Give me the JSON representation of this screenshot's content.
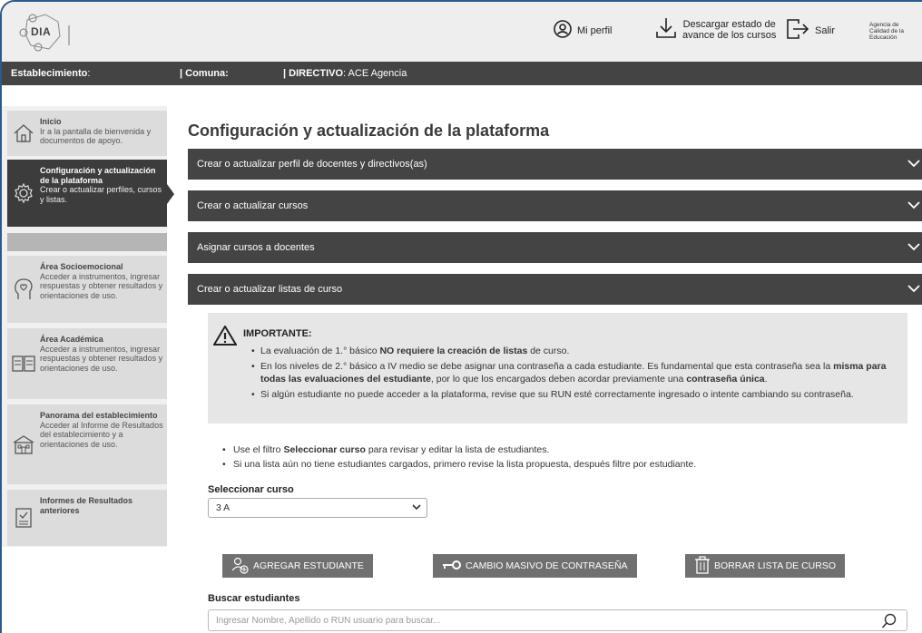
{
  "header": {
    "logo_text": "DIA",
    "profile_label": "Mi perfil",
    "download_line1": "Descargar estado de",
    "download_line2": "avance de los cursos",
    "exit_label": "Salir",
    "agency_line1": "Agencia de",
    "agency_line2": "Calidad de la",
    "agency_line3": "Educación"
  },
  "estab_bar": {
    "estab_label": "Establecimiento",
    "estab_suffix": ":",
    "comuna_label": "| Comuna:",
    "directivo_label": "| DIRECTIVO",
    "directivo_value": ": ACE Agencia"
  },
  "sidebar": {
    "items": [
      {
        "title": "Inicio",
        "desc": "Ir a la pantalla de bienvenida y documentos de apoyo.",
        "icon": "home-icon"
      },
      {
        "title": "Configuración y actualización de la plataforma",
        "desc": "Crear o actualizar perfiles, cursos y listas.",
        "icon": "gear-icon"
      },
      {
        "title": "Área Socioemocional",
        "desc": "Acceder a instrumentos, ingresar respuestas y obtener resultados y orientaciones de uso.",
        "icon": "head-heart-icon"
      },
      {
        "title": "Área Académica",
        "desc": "Acceder a instrumentos, ingresar respuestas y obtener resultados y orientaciones de uso.",
        "icon": "book-icon"
      },
      {
        "title": "Panorama del establecimiento",
        "desc": "Acceder al Informe de Resultados del establecimiento y a orientaciones de uso.",
        "icon": "school-icon"
      },
      {
        "title": "Informes de Resultados anteriores",
        "desc": "",
        "icon": "report-icon"
      }
    ]
  },
  "main": {
    "title": "Configuración y actualización de la plataforma",
    "accordions": [
      "Crear o actualizar perfil de docentes y directivos(as)",
      "Crear o actualizar cursos",
      "Asignar cursos a docentes",
      "Crear o actualizar listas de curso"
    ],
    "important": {
      "title": "IMPORTANTE:",
      "b1_pre": "La evaluación de 1.° básico ",
      "b1_bold": "NO requiere la creación de listas",
      "b1_post": " de curso.",
      "b2_pre": "En los niveles de 2.° básico a IV medio se debe asignar una contraseña a cada estudiante. Es fundamental que esta contraseña sea la ",
      "b2_bold1": "misma para todas las evaluaciones del estudiante",
      "b2_mid": ", por lo que los encargados deben acordar previamente una ",
      "b2_bold2": "contraseña única",
      "b2_post": ".",
      "b3": "Si algún estudiante no puede acceder a la plataforma, revise que su RUN esté correctamente ingresado o intente cambiando su contraseña."
    },
    "info": {
      "i1_pre": "Use el filtro ",
      "i1_bold": "Seleccionar curso",
      "i1_post": " para revisar y editar la lista de estudiantes.",
      "i2": "Si una lista aún no tiene estudiantes cargados, primero revise la lista propuesta, después filtre por estudiante."
    },
    "select_label": "Seleccionar curso",
    "select_value": "3 A",
    "buttons": {
      "add": "AGREGAR ESTUDIANTE",
      "password": "CAMBIO MASIVO DE CONTRASEÑA",
      "delete": "BORRAR LISTA DE CURSO"
    },
    "search_label": "Buscar estudiantes",
    "search_placeholder": "Ingresar Nombre, Apellido o RUN usuario para buscar..."
  },
  "colors": {
    "dark_bar": "#444444",
    "active_item": "#3c3c3c",
    "button": "#707070",
    "frame": "#2a5c8a"
  }
}
